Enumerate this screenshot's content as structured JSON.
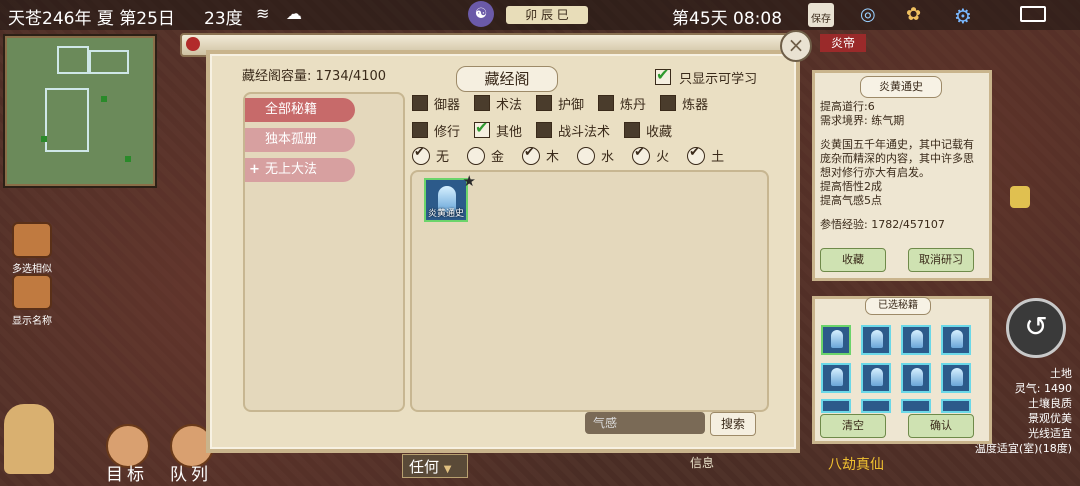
{
  "topbar": {
    "date": "天苍246年 夏 第25日",
    "temperature": "23度",
    "time_badge": "卯 辰 巳",
    "day_time": "第45天 08:08",
    "save_label": "保存"
  },
  "sidebar": {
    "multi_select_label": "多选相似",
    "show_name_label": "显示名称"
  },
  "bottom": {
    "target_label": "目标",
    "team_label": "队列",
    "any_label": "任何",
    "info_label": "信息",
    "immortal_label": "八劫真仙",
    "status_lines": [
      "土地",
      "灵气: 1490",
      "土壤良质",
      "景观优美",
      "光线适宜",
      "温度适宜(室)(18度)"
    ]
  },
  "header_tag": "炎帝",
  "library": {
    "capacity": "藏经阁容量: 1734/4100",
    "title": "藏经阁",
    "only_learnable_label": "只显示可学习",
    "only_learnable_checked": true,
    "categories": [
      {
        "label": "全部秘籍",
        "active": true
      },
      {
        "label": "独本孤册",
        "active": false
      },
      {
        "label": "无上大法",
        "active": false
      }
    ],
    "filter_row1": [
      {
        "label": "御器",
        "checked": false
      },
      {
        "label": "术法",
        "checked": false
      },
      {
        "label": "护御",
        "checked": false
      },
      {
        "label": "炼丹",
        "checked": false
      },
      {
        "label": "炼器",
        "checked": false
      }
    ],
    "filter_row2": [
      {
        "label": "修行",
        "checked": false
      },
      {
        "label": "其他",
        "checked": true
      },
      {
        "label": "战斗法术",
        "checked": false
      },
      {
        "label": "收藏",
        "checked": false
      }
    ],
    "elements": [
      {
        "label": "无",
        "checked": true
      },
      {
        "label": "金",
        "checked": false
      },
      {
        "label": "木",
        "checked": true
      },
      {
        "label": "水",
        "checked": false
      },
      {
        "label": "火",
        "checked": true
      },
      {
        "label": "土",
        "checked": true
      }
    ],
    "books": [
      {
        "name": "炎黄通史"
      }
    ],
    "search_placeholder": "气感",
    "search_label": "搜索"
  },
  "detail": {
    "title": "炎黄通史",
    "line1": "提高道行:6",
    "line2": "需求境界: 练气期",
    "desc": "炎黄国五千年通史，其中记载有庞杂而精深的内容，其中许多思想对修行亦大有启发。",
    "effect1": "提高悟性2成",
    "effect2": "提高气感5点",
    "exp": "参悟经验: 1782/457107",
    "collect_label": "收藏",
    "cancel_label": "取消研习"
  },
  "selected": {
    "title": "已选秘籍",
    "clear_label": "清空",
    "confirm_label": "确认"
  }
}
